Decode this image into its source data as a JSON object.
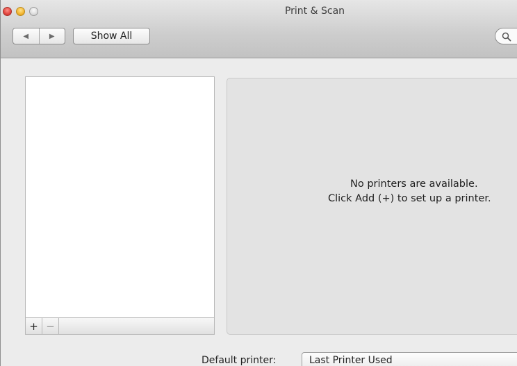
{
  "window": {
    "title": "Print & Scan"
  },
  "toolbar": {
    "back_glyph": "◀",
    "forward_glyph": "▶",
    "show_all_label": "Show All",
    "search_icon": "search-icon"
  },
  "printer_list": {
    "items": [],
    "add_label": "+",
    "remove_label": "−"
  },
  "detail": {
    "message_line1": "No printers are available.",
    "message_line2": "Click Add (+) to set up a printer."
  },
  "default_printer": {
    "label": "Default printer:",
    "value": "Last Printer Used"
  }
}
